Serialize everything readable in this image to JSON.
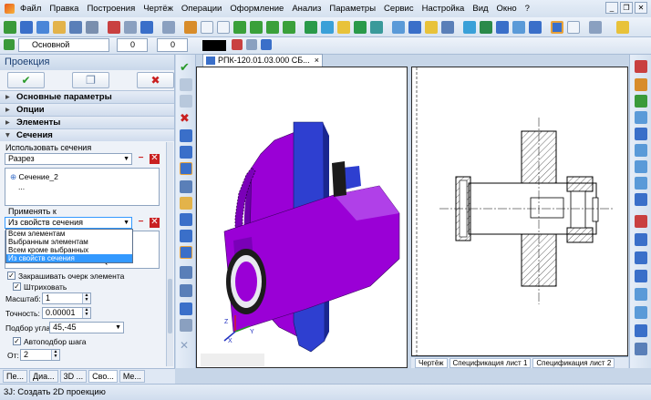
{
  "menu": [
    "Файл",
    "Правка",
    "Построения",
    "Чертёж",
    "Операции",
    "Оформление",
    "Анализ",
    "Параметры",
    "Сервис",
    "Настройка",
    "Вид",
    "Окно",
    "?"
  ],
  "toolbar2": {
    "layer_name": "Основной",
    "field1": "0",
    "field2": "0"
  },
  "document_tab": "РПК-120.01.03.000 СБ...",
  "panel": {
    "title": "Проекция",
    "sections": [
      "Основные параметры",
      "Опции",
      "Элементы",
      "Сечения"
    ],
    "use_sections_label": "Использовать сечения",
    "section_type": "Разрез",
    "section_items": [
      "Сечение_2",
      "..."
    ],
    "apply_to_label": "Применять к",
    "apply_to_value": "Из свойств сечения",
    "apply_options": [
      "Всем элементам",
      "Выбранным элементам",
      "Всем кроме выбранных",
      "Из свойств сечения"
    ],
    "fill_outline_label": "Закрашивать очерк элемента",
    "hatch_label": "Штриховать",
    "scale_label": "Масштаб:",
    "scale_value": "1",
    "precision_label": "Точность:",
    "precision_value": "0.00001",
    "angle_label": "Подбор угла:",
    "angle_value": "45,-45",
    "auto_step_label": "Автоподбор шага",
    "from_label": "От:",
    "from_value": "2"
  },
  "bottom_tabs": [
    "Пе...",
    "Диа...",
    "3D ...",
    "Сво...",
    "Ме..."
  ],
  "sheet_tabs": [
    "Чертёж",
    "Спецификация лист 1",
    "Спецификация лист 2"
  ],
  "status_text": "3J: Создать 2D проекцию",
  "colors": {
    "part_purple": "#9a00d6",
    "part_blue": "#2e3fd0",
    "accent": "#3399ff"
  }
}
